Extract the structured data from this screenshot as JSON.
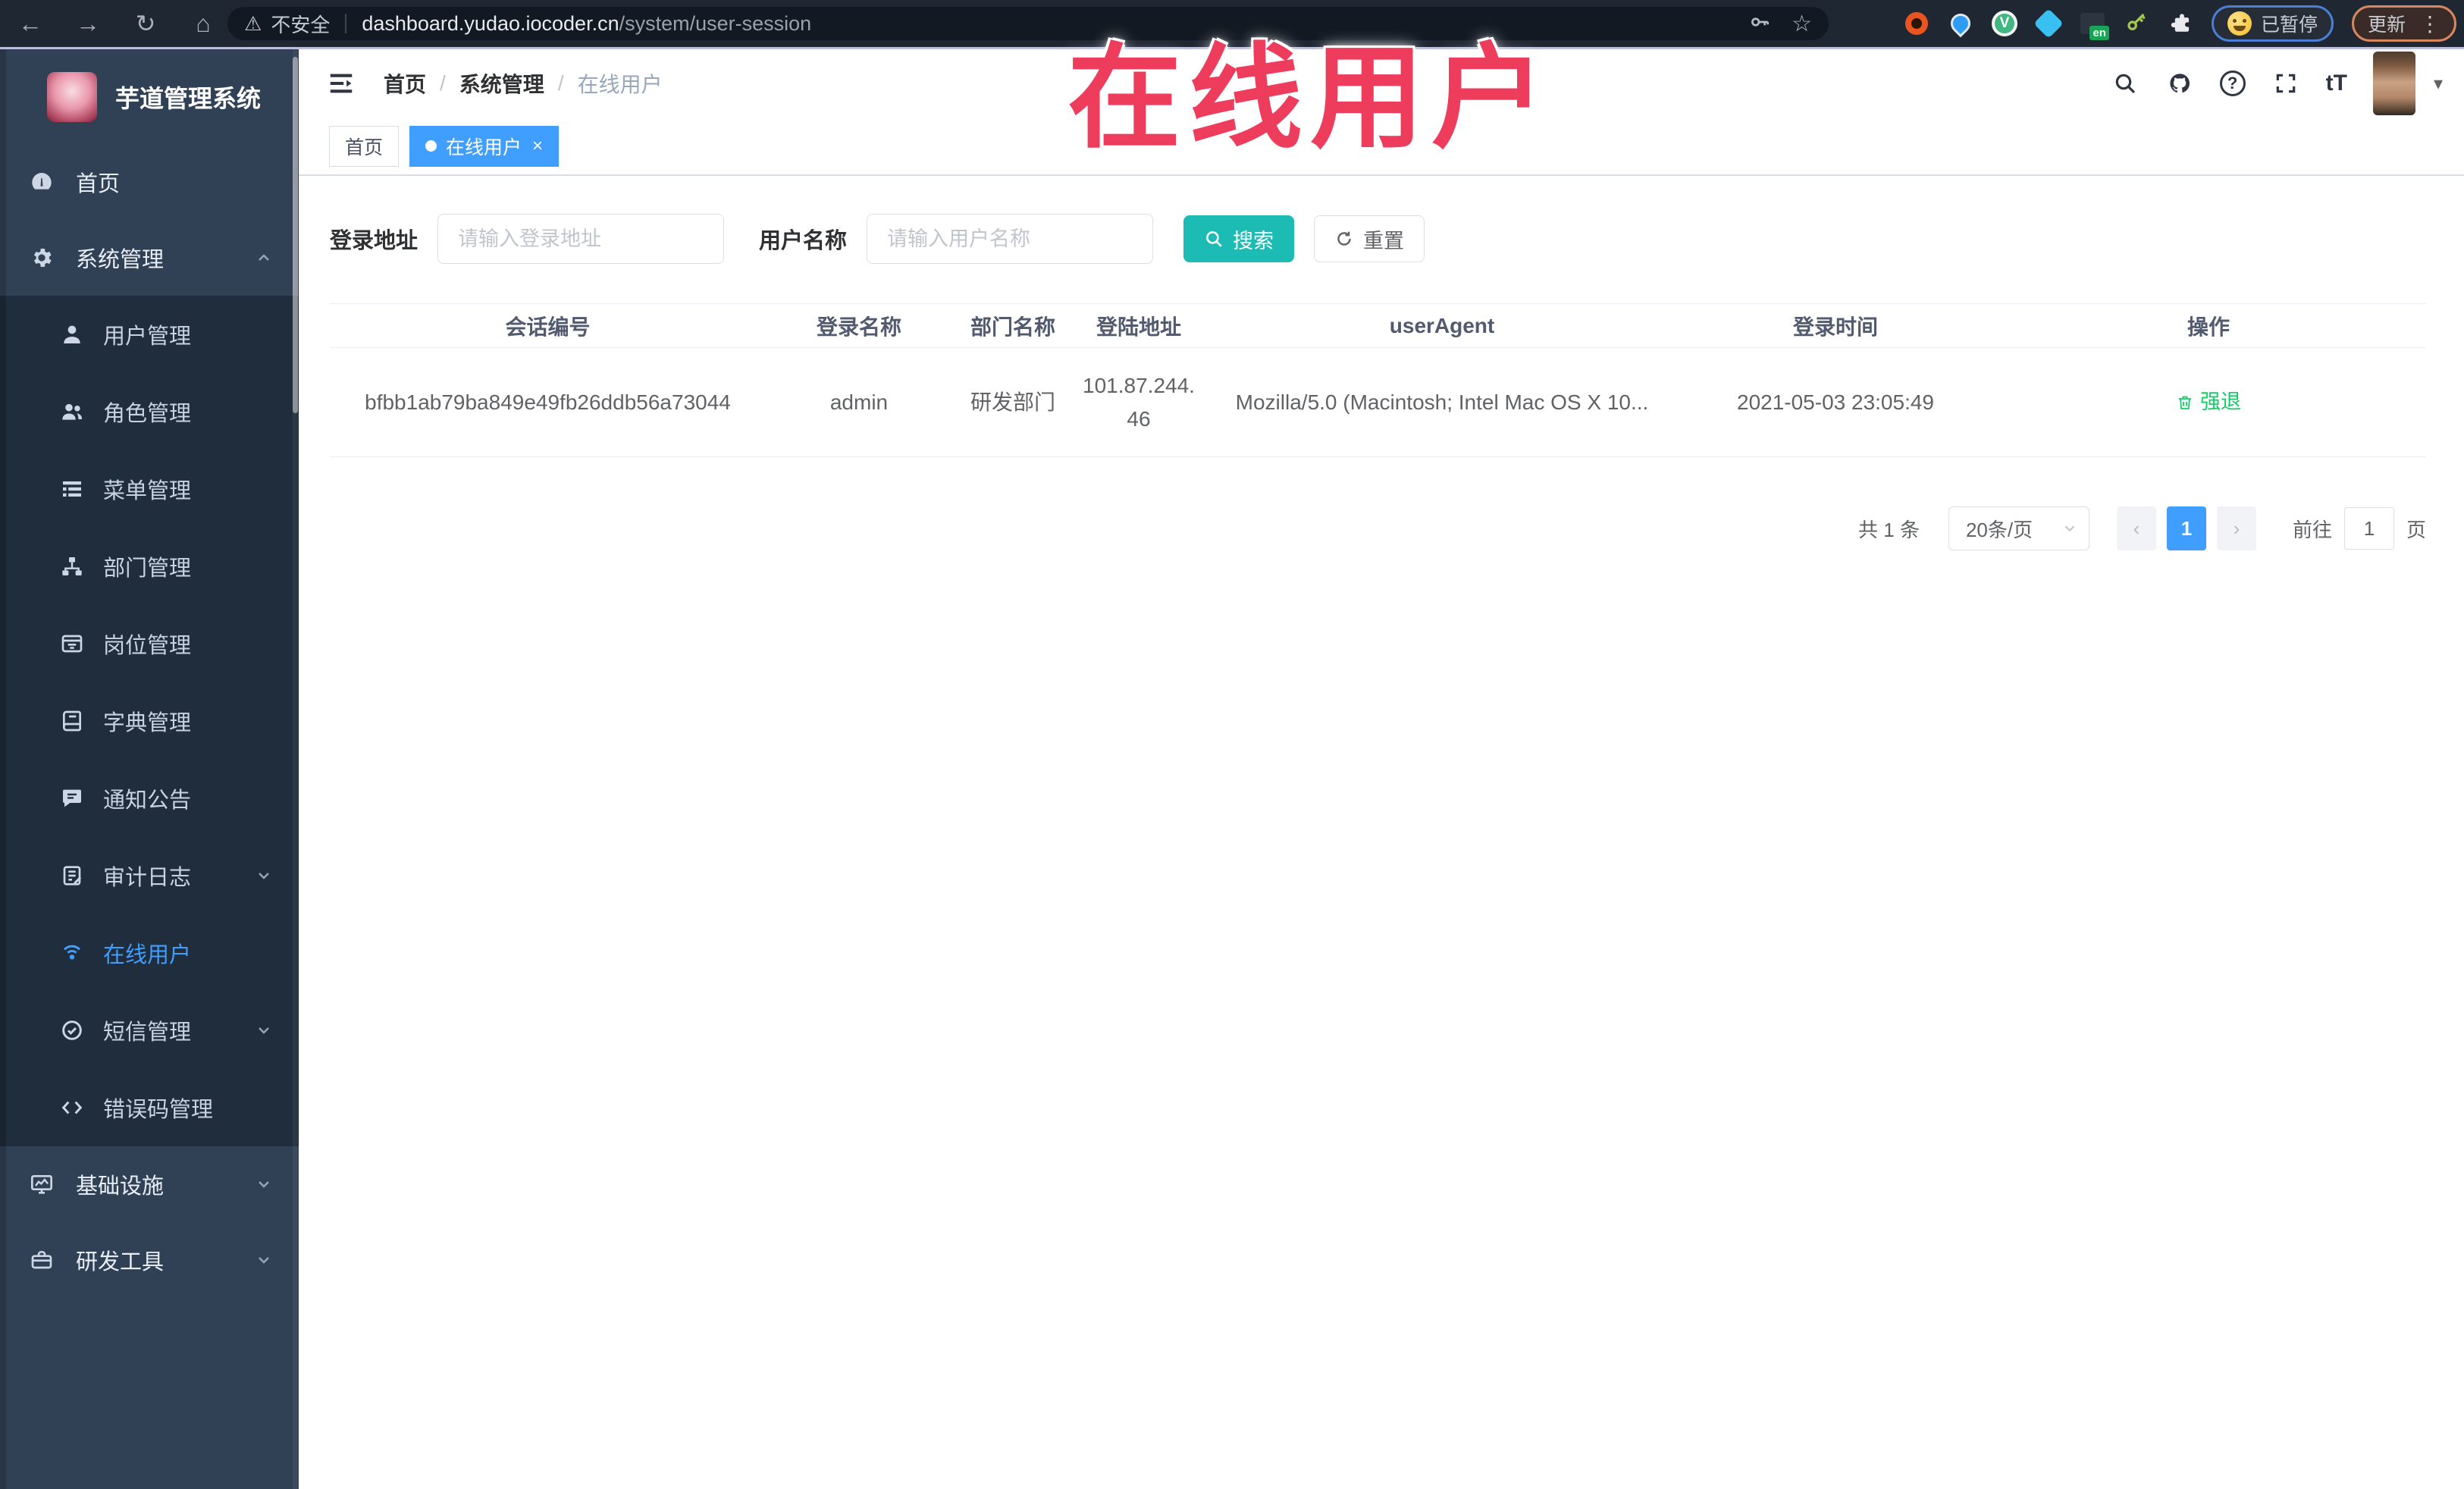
{
  "colors": {
    "accent": "#409eff",
    "search_button": "#1cbbb4",
    "action_green": "#13ce66",
    "annotation": "#ee3c5c",
    "sidebar_bg": "#304156",
    "submenu_bg": "#1f2d3c"
  },
  "glyphs": {
    "back": "←",
    "forward": "→",
    "reload": "↻",
    "home": "⌂",
    "warning": "⚠",
    "star": "☆",
    "dots": "⋮",
    "caret": "▾",
    "close": "×",
    "question": "?",
    "font_toggle": "tT",
    "prev": "‹",
    "next": "›",
    "vue": "V"
  },
  "browser": {
    "security_label": "不安全",
    "url_host": "dashboard.yudao.iocoder.cn",
    "url_path": "/system/user-session",
    "en_badge": "en",
    "paused_label": "已暂停",
    "update_label": "更新"
  },
  "annotation": {
    "text": "在线用户"
  },
  "sidebar": {
    "app_title": "芋道管理系统",
    "items": [
      {
        "label": "首页"
      },
      {
        "label": "系统管理"
      },
      {
        "label": "用户管理"
      },
      {
        "label": "角色管理"
      },
      {
        "label": "菜单管理"
      },
      {
        "label": "部门管理"
      },
      {
        "label": "岗位管理"
      },
      {
        "label": "字典管理"
      },
      {
        "label": "通知公告"
      },
      {
        "label": "审计日志"
      },
      {
        "label": "在线用户"
      },
      {
        "label": "短信管理"
      },
      {
        "label": "错误码管理"
      },
      {
        "label": "基础设施"
      },
      {
        "label": "研发工具"
      }
    ]
  },
  "header": {
    "breadcrumb": [
      "首页",
      "系统管理",
      "在线用户"
    ]
  },
  "tabs": {
    "home": "首页",
    "current": "在线用户"
  },
  "filters": {
    "address_label": "登录地址",
    "address_placeholder": "请输入登录地址",
    "username_label": "用户名称",
    "username_placeholder": "请输入用户名称",
    "search_label": "搜索",
    "reset_label": "重置"
  },
  "table": {
    "columns": [
      "会话编号",
      "登录名称",
      "部门名称",
      "登陆地址",
      "userAgent",
      "登录时间",
      "操作"
    ],
    "rows": [
      {
        "session_id": "bfbb1ab79ba849e49fb26ddb56a73044",
        "username": "admin",
        "dept": "研发部门",
        "ip": "101.87.244.46",
        "user_agent": "Mozilla/5.0 (Macintosh; Intel Mac OS X 10...",
        "login_time": "2021-05-03 23:05:49",
        "action": "强退"
      }
    ]
  },
  "pagination": {
    "total": "共 1 条",
    "page_size": "20条/页",
    "page": "1",
    "goto_label": "前往",
    "goto_value": "1",
    "unit_label": "页"
  }
}
